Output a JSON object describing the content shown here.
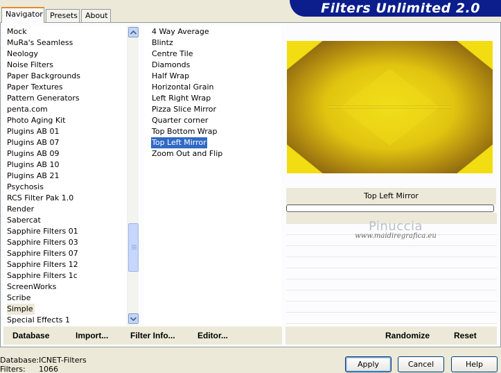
{
  "tabs": [
    {
      "label": "Navigator",
      "active": true
    },
    {
      "label": "Presets",
      "active": false
    },
    {
      "label": "About",
      "active": false
    }
  ],
  "brand": {
    "title": "Filters Unlimited 2.0",
    "color": "#0b1e8c"
  },
  "categories": {
    "items": [
      "Mock",
      "MuRa's Seamless",
      "Neology",
      "Noise Filters",
      "Paper Backgrounds",
      "Paper Textures",
      "Pattern Generators",
      "penta.com",
      "Photo Aging Kit",
      "Plugins AB 01",
      "Plugins AB 07",
      "Plugins AB 09",
      "Plugins AB 10",
      "Plugins AB 21",
      "Psychosis",
      "RCS Filter Pak 1.0",
      "Render",
      "Sabercat",
      "Sapphire Filters 01",
      "Sapphire Filters 03",
      "Sapphire Filters 07",
      "Sapphire Filters 12",
      "Sapphire Filters 1c",
      "ScreenWorks",
      "Scribe",
      "Simple",
      "Special Effects 1"
    ],
    "selected": "Simple",
    "scroll_up_icon": "chevron-up-icon",
    "scroll_down_icon": "chevron-down-icon"
  },
  "filters": {
    "items": [
      "4 Way Average",
      "Blintz",
      "Centre Tile",
      "Diamonds",
      "Half Wrap",
      "Horizontal Grain",
      "Left Right Wrap",
      "Pizza Slice Mirror",
      "Quarter corner",
      "Top Bottom Wrap",
      "Top Left Mirror",
      "Zoom Out and Flip"
    ],
    "selected": "Top Left Mirror",
    "selection_color": "#316ac5"
  },
  "preview": {
    "filter_name": "Top Left Mirror",
    "progress": 0,
    "colors": {
      "center": "#f4e31a",
      "edge": "#6b4a10",
      "corner": "#f0da10"
    }
  },
  "watermark": {
    "name": "Pinuccia",
    "url": "www.maidiregrafica.eu"
  },
  "tools": {
    "database": "Database",
    "import": "Import...",
    "filter_info": "Filter Info...",
    "editor": "Editor...",
    "randomize": "Randomize",
    "reset": "Reset"
  },
  "status": {
    "database_label": "Database:",
    "database_value": "ICNET-Filters",
    "filters_label": "Filters:",
    "filters_value": "1066"
  },
  "buttons": {
    "apply": "Apply",
    "cancel": "Cancel",
    "help": "Help"
  }
}
